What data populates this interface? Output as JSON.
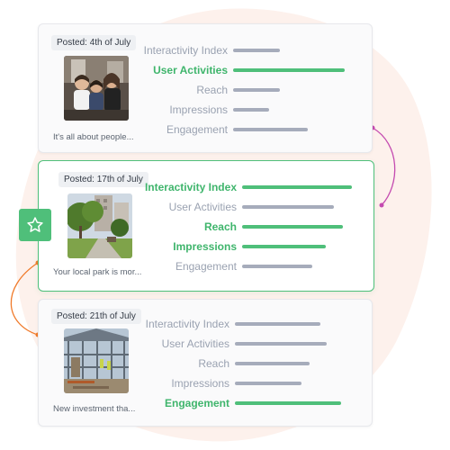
{
  "cards": [
    {
      "posted": "Posted: 4th of July",
      "caption": "It's all about people...",
      "thumb_icon": "family-photo",
      "selected": false,
      "metrics": [
        {
          "label": "Interactivity Index",
          "value": 0.42,
          "active": false
        },
        {
          "label": "User Activities",
          "value": 1.0,
          "active": true
        },
        {
          "label": "Reach",
          "value": 0.42,
          "active": false
        },
        {
          "label": "Impressions",
          "value": 0.32,
          "active": false
        },
        {
          "label": "Engagement",
          "value": 0.67,
          "active": false
        }
      ]
    },
    {
      "posted": "Posted: 17th of July",
      "caption": "Your local park is mor...",
      "thumb_icon": "park-photo",
      "selected": true,
      "metrics": [
        {
          "label": "Interactivity Index",
          "value": 0.98,
          "active": true
        },
        {
          "label": "User Activities",
          "value": 0.82,
          "active": false
        },
        {
          "label": "Reach",
          "value": 0.9,
          "active": true
        },
        {
          "label": "Impressions",
          "value": 0.75,
          "active": true
        },
        {
          "label": "Engagement",
          "value": 0.63,
          "active": false
        }
      ]
    },
    {
      "posted": "Posted: 21th of July",
      "caption": "New investment tha...",
      "thumb_icon": "construction-photo",
      "selected": false,
      "metrics": [
        {
          "label": "Interactivity Index",
          "value": 0.77,
          "active": false
        },
        {
          "label": "User Activities",
          "value": 0.82,
          "active": false
        },
        {
          "label": "Reach",
          "value": 0.67,
          "active": false
        },
        {
          "label": "Impressions",
          "value": 0.6,
          "active": false
        },
        {
          "label": "Engagement",
          "value": 0.95,
          "active": true
        }
      ]
    }
  ],
  "star_icon": "star-icon",
  "colors": {
    "accent_green": "#4fbf7a",
    "muted_bar": "#a6acbb",
    "connector_purple": "#c44ab0",
    "connector_orange": "#f07a2a",
    "blob": "#fdf0ea"
  }
}
